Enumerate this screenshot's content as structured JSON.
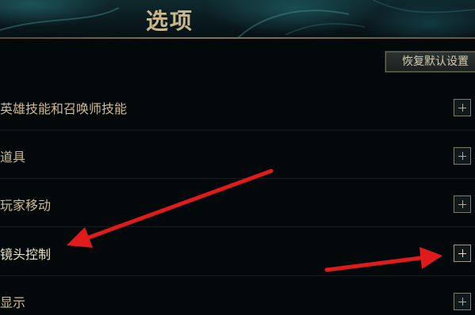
{
  "header": {
    "title": "选项"
  },
  "toolbar": {
    "reset_label": "恢复默认设置"
  },
  "settings": {
    "items": [
      {
        "label": "英雄技能和召唤师技能"
      },
      {
        "label": "道具"
      },
      {
        "label": "玩家移动"
      },
      {
        "label": "镜头控制"
      },
      {
        "label": "显示"
      }
    ]
  },
  "colors": {
    "background": "#03080a",
    "gold_text": "#cdbc8f",
    "annotation_arrow": "#e01b1b"
  }
}
